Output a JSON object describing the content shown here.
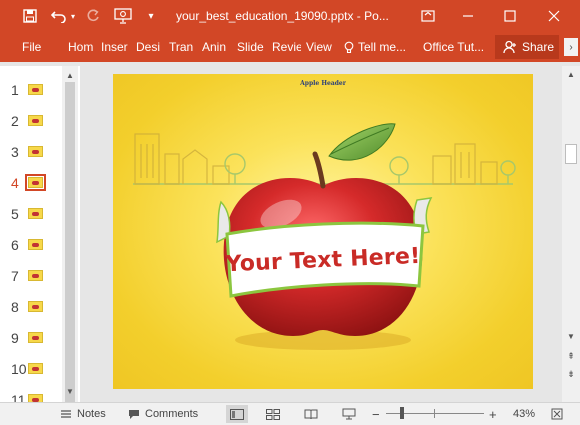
{
  "titlebar": {
    "document_title": "your_best_education_19090.pptx - Po...",
    "quick_access": [
      "save-icon",
      "undo-icon",
      "redo-icon",
      "slideshow-icon",
      "customize-icon"
    ],
    "window_buttons": [
      "ribbon-display-icon",
      "minimize-icon",
      "maximize-icon",
      "close-icon"
    ]
  },
  "ribbon": {
    "file": "File",
    "tabs": [
      "Hom",
      "Inser",
      "Desi",
      "Tran",
      "Anin",
      "Slide",
      "Revie",
      "View"
    ],
    "tell_me": "Tell me...",
    "office_tutor": "Office Tut...",
    "share": "Share"
  },
  "thumbnails": {
    "numbers": [
      "1",
      "2",
      "3",
      "4",
      "5",
      "6",
      "7",
      "8",
      "9",
      "10",
      "11"
    ],
    "active_index": 3
  },
  "slide": {
    "header": "Apple Header",
    "banner_text": "Your Text Here!"
  },
  "statusbar": {
    "notes": "Notes",
    "comments": "Comments",
    "zoom_out": "−",
    "zoom_in": "+",
    "zoom_level": "43%"
  },
  "colors": {
    "accent": "#d24726",
    "slide_background": "#f7d84a",
    "apple": "#d52a2a",
    "leaf": "#6aa83a",
    "banner_stroke": "#8cc63f"
  }
}
